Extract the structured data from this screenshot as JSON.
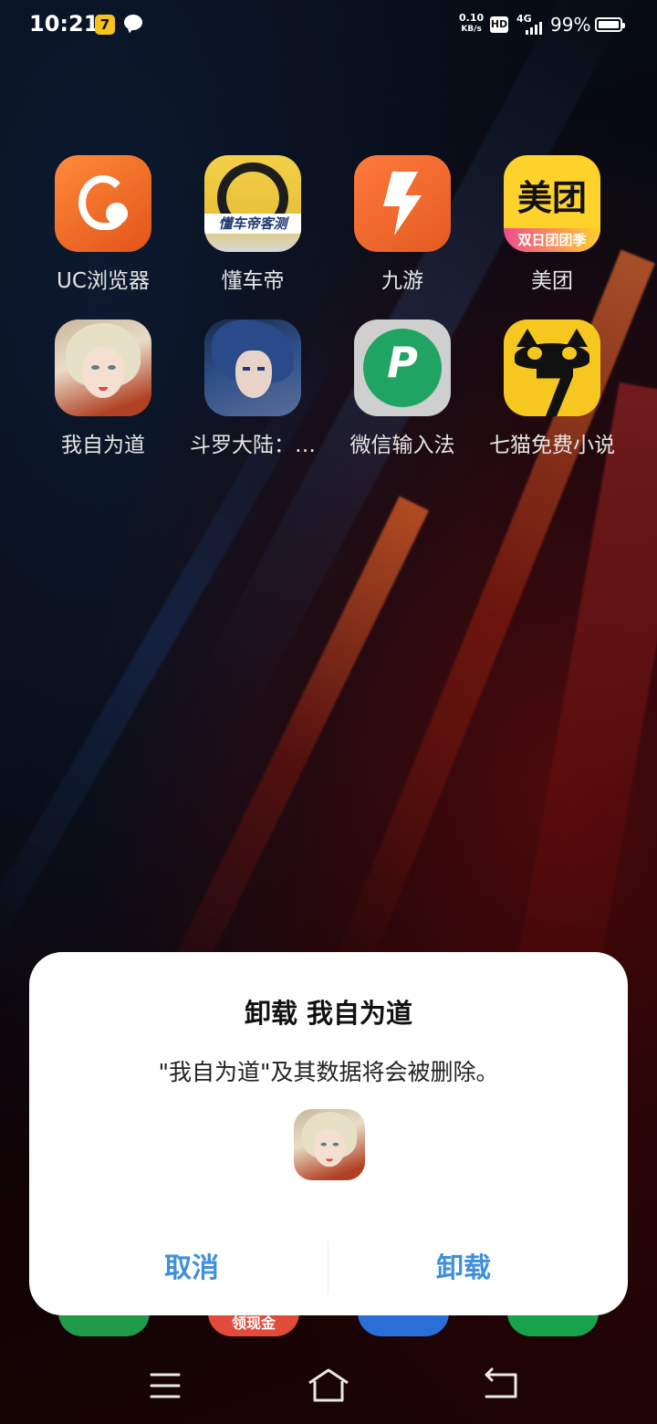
{
  "status_bar": {
    "time": "10:21",
    "speed_value": "0.10",
    "speed_unit": "KB/s",
    "hd": "HD",
    "network": "4G",
    "battery": "99%",
    "notification_icons": [
      "qimao-app-icon",
      "chat-bubble-icon"
    ]
  },
  "apps": [
    {
      "label": "UC浏览器",
      "icon": "uc-browser-icon"
    },
    {
      "label": "懂车帝",
      "icon": "dongchedi-icon",
      "icon_text": "懂车帝客测"
    },
    {
      "label": "九游",
      "icon": "jiuyou-icon"
    },
    {
      "label": "美团",
      "icon": "meituan-icon",
      "icon_text": "美团",
      "icon_band": "双日团团季"
    },
    {
      "label": "我自为道",
      "icon": "wozi-weidao-game-icon"
    },
    {
      "label": "斗罗大陆：…",
      "icon": "douluo-dalu-game-icon"
    },
    {
      "label": "微信输入法",
      "icon": "wechat-input-icon"
    },
    {
      "label": "七猫免费小说",
      "icon": "qimao-novel-icon"
    }
  ],
  "dock": {
    "partial_label": "领现金"
  },
  "dialog": {
    "title": "卸载 我自为道",
    "message": "\"我自为道\"及其数据将会被删除。",
    "cancel": "取消",
    "uninstall": "卸载"
  },
  "colors": {
    "dialog_button": "#3f8fdb",
    "dialog_bg": "#ffffff"
  },
  "nav": [
    "menu-icon",
    "home-icon",
    "back-icon"
  ]
}
